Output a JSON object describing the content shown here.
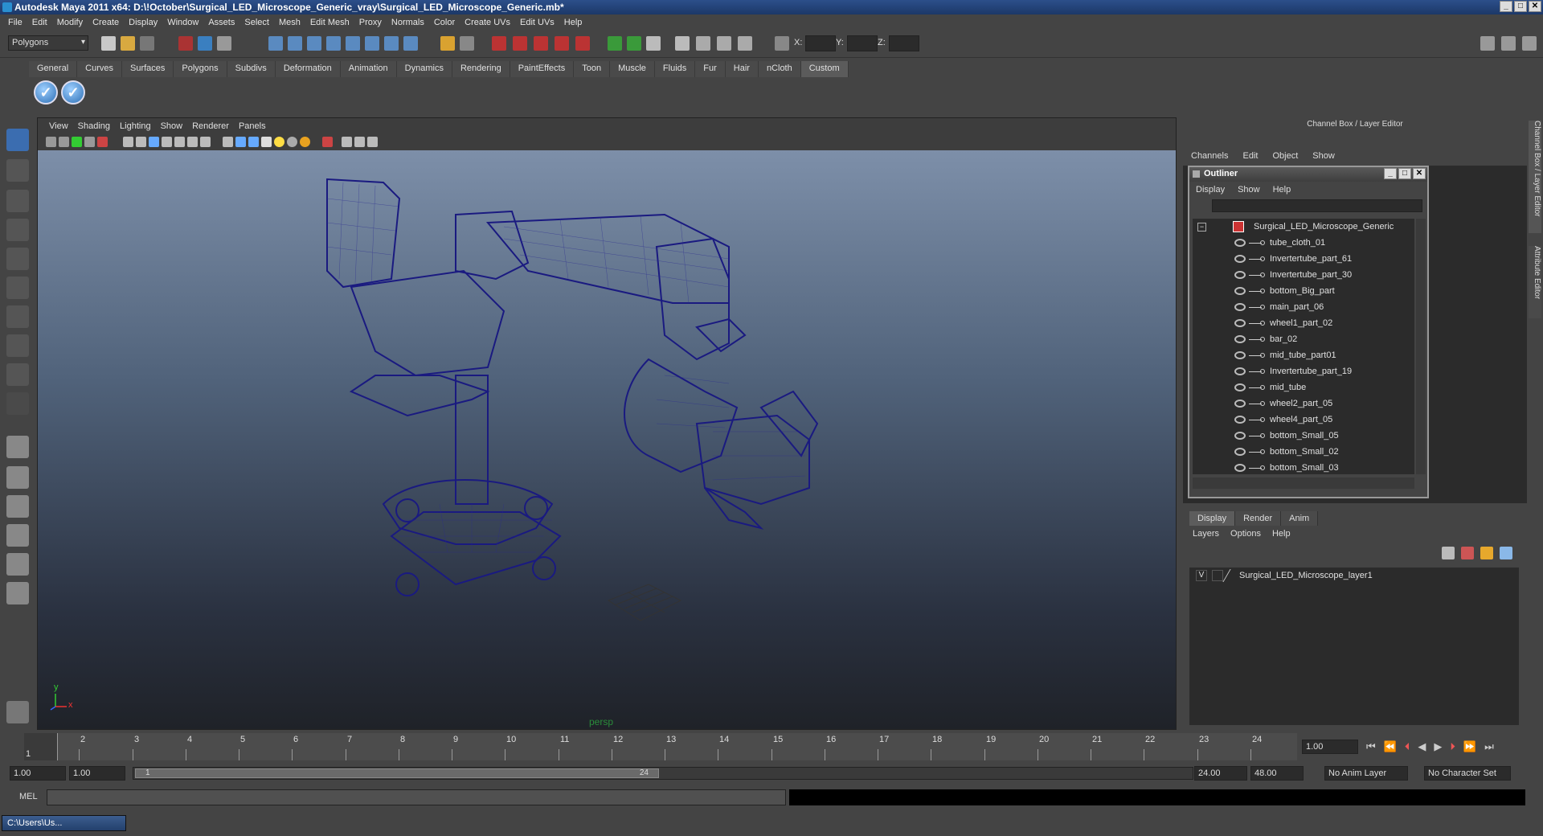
{
  "title": "Autodesk Maya 2011 x64: D:\\!October\\Surgical_LED_Microscope_Generic_vray\\Surgical_LED_Microscope_Generic.mb*",
  "menu": [
    "File",
    "Edit",
    "Modify",
    "Create",
    "Display",
    "Window",
    "Assets",
    "Select",
    "Mesh",
    "Edit Mesh",
    "Proxy",
    "Normals",
    "Color",
    "Create UVs",
    "Edit UVs",
    "Help"
  ],
  "status": {
    "mode": "Polygons",
    "x_label": "X:",
    "y_label": "Y:",
    "z_label": "Z:"
  },
  "shelf_tabs": [
    "General",
    "Curves",
    "Surfaces",
    "Polygons",
    "Subdivs",
    "Deformation",
    "Animation",
    "Dynamics",
    "Rendering",
    "PaintEffects",
    "Toon",
    "Muscle",
    "Fluids",
    "Fur",
    "Hair",
    "nCloth",
    "Custom"
  ],
  "shelf_active": "Custom",
  "viewport": {
    "menu": [
      "View",
      "Shading",
      "Lighting",
      "Show",
      "Renderer",
      "Panels"
    ],
    "camera": "persp",
    "axis_x": "x",
    "axis_y": "y",
    "wire_color": "#1a1a80"
  },
  "channelbox": {
    "title": "Channel Box / Layer Editor",
    "menu": [
      "Channels",
      "Edit",
      "Object",
      "Show"
    ]
  },
  "side_tabs": [
    "Channel Box / Layer Editor",
    "Attribute Editor"
  ],
  "outliner": {
    "title": "Outliner",
    "menu": [
      "Display",
      "Show",
      "Help"
    ],
    "root": "Surgical_LED_Microscope_Generic",
    "items": [
      "tube_cloth_01",
      "Invertertube_part_61",
      "Invertertube_part_30",
      "bottom_Big_part",
      "main_part_06",
      "wheel1_part_02",
      "bar_02",
      "mid_tube_part01",
      "Invertertube_part_19",
      "mid_tube",
      "wheel2_part_05",
      "wheel4_part_05",
      "bottom_Small_05",
      "bottom_Small_02",
      "bottom_Small_03"
    ]
  },
  "layers": {
    "tabs": [
      "Display",
      "Render",
      "Anim"
    ],
    "menu": [
      "Layers",
      "Options",
      "Help"
    ],
    "rows": [
      {
        "v": "V",
        "name": "Surgical_LED_Microscope_layer1"
      }
    ]
  },
  "timeline": {
    "ticks": [
      "1",
      "2",
      "3",
      "4",
      "5",
      "6",
      "7",
      "8",
      "9",
      "10",
      "11",
      "12",
      "13",
      "14",
      "15",
      "16",
      "17",
      "18",
      "19",
      "20",
      "21",
      "22",
      "23",
      "24"
    ],
    "current": "1.00",
    "cursor_label": "1"
  },
  "range": {
    "start": "1.00",
    "start2": "1.00",
    "slider_start": "1",
    "slider_end": "24",
    "end": "24.00",
    "end2": "48.00",
    "anim_layer": "No Anim Layer",
    "char_set": "No Character Set"
  },
  "mel": {
    "label": "MEL"
  },
  "taskbar": {
    "item": "C:\\Users\\Us..."
  }
}
